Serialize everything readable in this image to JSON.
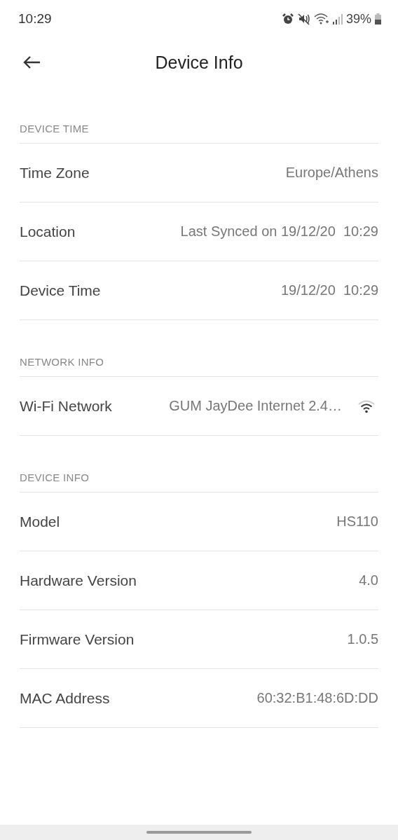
{
  "status_bar": {
    "time": "10:29",
    "battery": "39%"
  },
  "header": {
    "title": "Device Info"
  },
  "sections": [
    {
      "title": "DEVICE TIME",
      "rows": [
        {
          "kind": "text",
          "label": "Time Zone",
          "value": "Europe/Athens"
        },
        {
          "kind": "text",
          "label": "Location",
          "value": "Last Synced on 19/12/20  10:29"
        },
        {
          "kind": "text",
          "label": "Device Time",
          "value": "19/12/20  10:29"
        }
      ]
    },
    {
      "title": "NETWORK INFO",
      "rows": [
        {
          "kind": "wifi",
          "label": "Wi-Fi Network",
          "value": "GUM JayDee Internet 2.4…"
        }
      ]
    },
    {
      "title": "DEVICE INFO",
      "rows": [
        {
          "kind": "text",
          "label": "Model",
          "value": "HS110"
        },
        {
          "kind": "text",
          "label": "Hardware Version",
          "value": "4.0"
        },
        {
          "kind": "text",
          "label": "Firmware Version",
          "value": "1.0.5"
        },
        {
          "kind": "text",
          "label": "MAC Address",
          "value": "60:32:B1:48:6D:DD"
        }
      ]
    }
  ]
}
